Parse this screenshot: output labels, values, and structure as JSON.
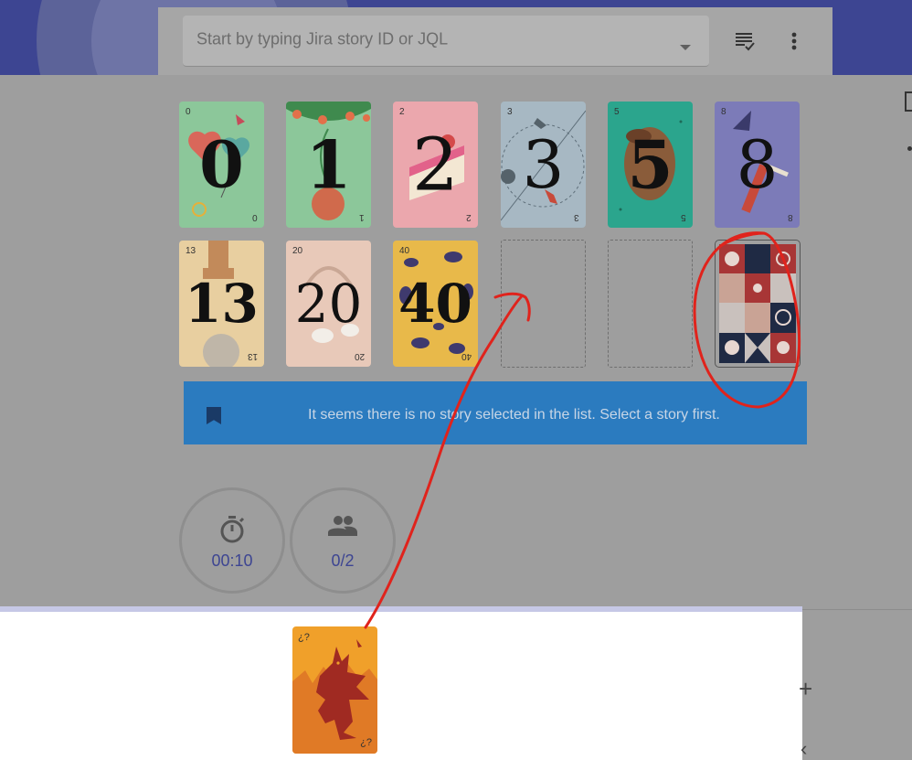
{
  "search": {
    "placeholder": "Start by typing Jira story ID or JQL"
  },
  "toolbar": {
    "checklist_icon": "checklist-icon",
    "menu_icon": "more-vert-icon"
  },
  "cards": [
    {
      "value": "0",
      "bg": "#8cc79a"
    },
    {
      "value": "1",
      "bg": "#8cc79a"
    },
    {
      "value": "2",
      "bg": "#eba7ad"
    },
    {
      "value": "3",
      "bg": "#a7b8c3"
    },
    {
      "value": "5",
      "bg": "#2ba58d"
    },
    {
      "value": "8",
      "bg": "#7c7bb8"
    },
    {
      "value": "13",
      "bg": "#e8cfa0"
    },
    {
      "value": "20",
      "bg": "#e8c9b9"
    },
    {
      "value": "40",
      "bg": "#e8b94a"
    }
  ],
  "banner": {
    "message": "It seems there is no story selected in the list. Select a story first."
  },
  "stats": {
    "timer": "00:10",
    "participants": "0/2"
  },
  "hand": {
    "card_marks": [
      "¿?",
      "¿?"
    ]
  },
  "colors": {
    "primary": "#3d4592",
    "banner": "#2b7bbf",
    "annotation": "#e0231c"
  }
}
